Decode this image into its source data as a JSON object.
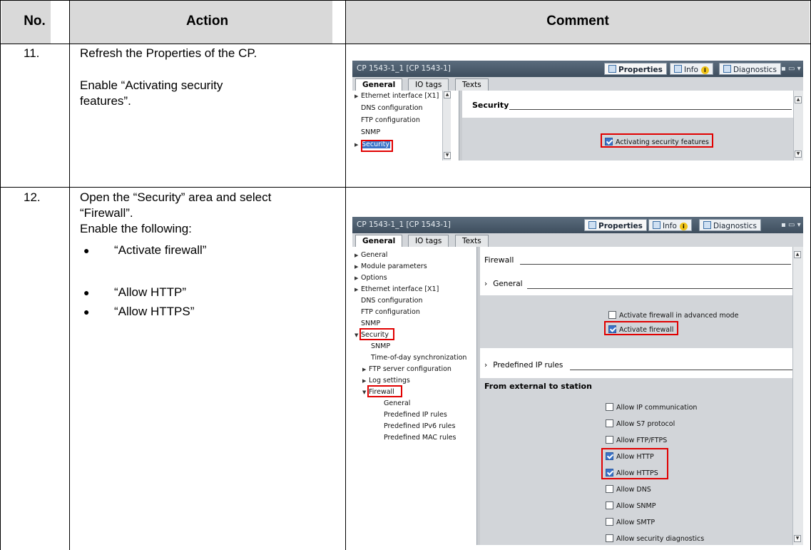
{
  "header": {
    "no": "No.",
    "action": "Action",
    "comment": "Comment"
  },
  "rows": [
    {
      "no": "11.",
      "action": [
        "Refresh the Properties of the CP.",
        "Enable “Activating security features”."
      ],
      "panel": {
        "title": "CP 1543-1_1 [CP 1543-1]",
        "btn_properties": "Properties",
        "btn_info": "Info",
        "btn_diagnostics": "Diagnostics",
        "tabs": [
          "General",
          "IO tags",
          "Texts"
        ],
        "nav": [
          "Ethernet interface [X1]",
          "DNS configuration",
          "FTP configuration",
          "SNMP",
          "Security"
        ],
        "section": "Security",
        "checkbox_label": "Activating security features",
        "checkbox_checked": true
      }
    },
    {
      "no": "12.",
      "action_intro": "Open the “Security” area and select “Firewall”.",
      "action_enable": "Enable the following:",
      "bullets": [
        "“Activate firewall”",
        "“Allow HTTP”",
        "“Allow HTTPS”"
      ],
      "panel": {
        "title": "CP 1543-1_1 [CP 1543-1]",
        "btn_properties": "Properties",
        "btn_info": "Info",
        "btn_diagnostics": "Diagnostics",
        "tabs": [
          "General",
          "IO tags",
          "Texts"
        ],
        "nav": [
          "General",
          "Module parameters",
          "Options",
          "Ethernet interface [X1]",
          "DNS configuration",
          "FTP configuration",
          "SNMP",
          "Security",
          "SNMP",
          "Time-of-day synchronization",
          "FTP server configuration",
          "Log settings",
          "Firewall",
          "General",
          "Predefined IP rules",
          "Predefined IPv6 rules",
          "Predefined MAC rules"
        ],
        "section_firewall": "Firewall",
        "section_general": "General",
        "cb_advanced": "Activate firewall in advanced mode",
        "cb_activate": "Activate firewall",
        "section_predefined": "Predefined IP rules",
        "from_external": "From external to station",
        "rules": [
          {
            "label": "Allow IP communication",
            "checked": false
          },
          {
            "label": "Allow S7 protocol",
            "checked": false
          },
          {
            "label": "Allow FTP/FTPS",
            "checked": false
          },
          {
            "label": "Allow HTTP",
            "checked": true
          },
          {
            "label": "Allow HTTPS",
            "checked": true
          },
          {
            "label": "Allow DNS",
            "checked": false
          },
          {
            "label": "Allow SNMP",
            "checked": false
          },
          {
            "label": "Allow SMTP",
            "checked": false
          },
          {
            "label": "Allow security diagnostics",
            "checked": false
          }
        ]
      }
    }
  ],
  "colors": {
    "header_bg": "#d9d9d9",
    "highlight": "#e10000",
    "checkbox_on": "#3b73c8"
  },
  "icons": [
    "properties-icon",
    "info-icon",
    "info-warning-icon",
    "diagnostics-icon",
    "window-controls-icon"
  ]
}
